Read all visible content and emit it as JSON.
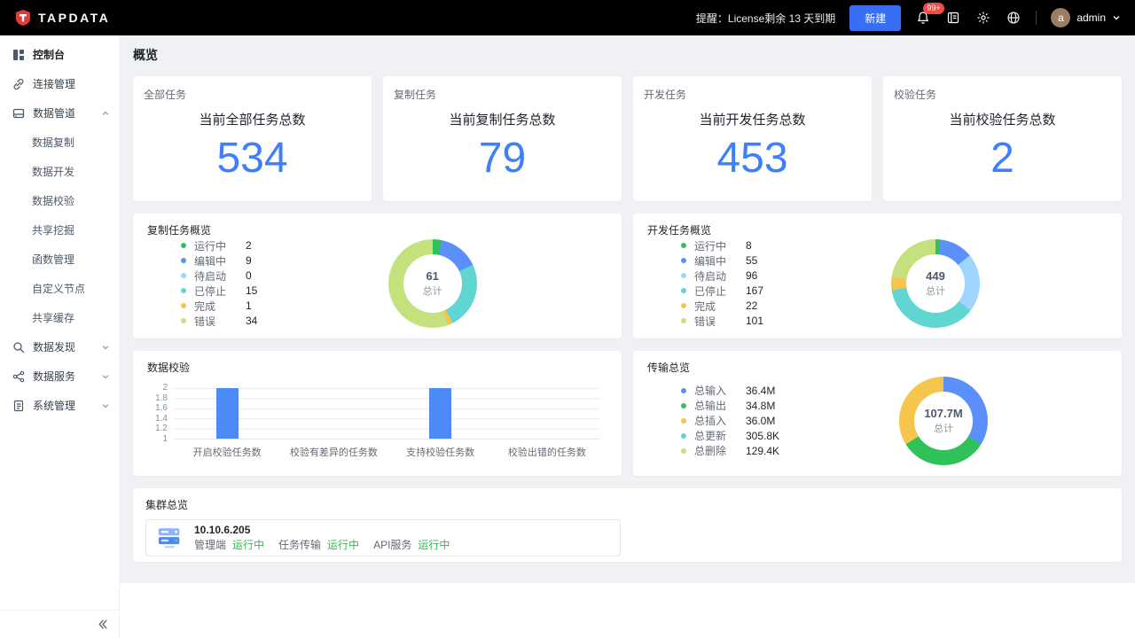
{
  "colors": {
    "accent": "#3d7ffc",
    "success": "#27c24c",
    "navbar_bg": "#000000",
    "badge_red": "#f54a45"
  },
  "navbar": {
    "brand": "TAPDATA",
    "license_notice": "提醒：License剩余 13 天到期",
    "new_button_label": "新建",
    "notification_badge": "99+",
    "avatar_letter": "a",
    "username": "admin"
  },
  "sidebar": {
    "items": [
      {
        "label": "控制台",
        "icon": "dashboard-icon",
        "active": true
      },
      {
        "label": "连接管理",
        "icon": "connection-icon"
      },
      {
        "label": "数据管道",
        "icon": "pipeline-icon",
        "expanded": true,
        "children": [
          "数据复制",
          "数据开发",
          "数据校验",
          "共享挖掘",
          "函数管理",
          "自定义节点",
          "共享缓存"
        ]
      },
      {
        "label": "数据发现",
        "icon": "discovery-icon",
        "expanded": false
      },
      {
        "label": "数据服务",
        "icon": "service-icon",
        "expanded": false
      },
      {
        "label": "系统管理",
        "icon": "system-icon",
        "expanded": false
      }
    ]
  },
  "page": {
    "title": "概览"
  },
  "stat_cards": [
    {
      "tag": "全部任务",
      "title": "当前全部任务总数",
      "value": "534"
    },
    {
      "tag": "复制任务",
      "title": "当前复制任务总数",
      "value": "79"
    },
    {
      "tag": "开发任务",
      "title": "当前开发任务总数",
      "value": "453"
    },
    {
      "tag": "校验任务",
      "title": "当前校验任务总数",
      "value": "2"
    }
  ],
  "chart_data": [
    {
      "type": "pie",
      "variant": "donut",
      "title": "复制任务概览",
      "legend_position": "left",
      "labels": [
        "运行中",
        "编辑中",
        "待启动",
        "已停止",
        "完成",
        "错误"
      ],
      "values": [
        2,
        9,
        0,
        15,
        1,
        34
      ],
      "display_values": [
        "2",
        "9",
        "0",
        "15",
        "1",
        "34"
      ],
      "center_total": "61",
      "center_label": "总计",
      "colors": [
        "#2fc25b",
        "#5b8ff9",
        "#9fd4fd",
        "#5fd6d2",
        "#f6c54c",
        "#c5e17e"
      ]
    },
    {
      "type": "pie",
      "variant": "donut",
      "title": "开发任务概览",
      "legend_position": "left",
      "labels": [
        "运行中",
        "编辑中",
        "待启动",
        "已停止",
        "完成",
        "错误"
      ],
      "values": [
        8,
        55,
        96,
        167,
        22,
        101
      ],
      "display_values": [
        "8",
        "55",
        "96",
        "167",
        "22",
        "101"
      ],
      "center_total": "449",
      "center_label": "总计",
      "colors": [
        "#2fc25b",
        "#5b8ff9",
        "#9fd4fd",
        "#5fd6d2",
        "#f6c54c",
        "#c5e17e"
      ]
    },
    {
      "type": "bar",
      "title": "数据校验",
      "grid": true,
      "categories": [
        "开启校验任务数",
        "校验有差异的任务数",
        "支持校验任务数",
        "校验出错的任务数"
      ],
      "values": [
        2,
        0,
        2,
        0
      ],
      "ylim": [
        1,
        2
      ],
      "yticks": [
        "2",
        "1.8",
        "1.6",
        "1.4",
        "1.2",
        "1"
      ],
      "bar_color": "#4c8af8"
    },
    {
      "type": "pie",
      "variant": "donut",
      "title": "传输总览",
      "legend_position": "left",
      "labels": [
        "总输入",
        "总输出",
        "总插入",
        "总更新",
        "总删除"
      ],
      "values": [
        36400000,
        34800000,
        36000000,
        305800,
        129400
      ],
      "display_values": [
        "36.4M",
        "34.8M",
        "36.0M",
        "305.8K",
        "129.4K"
      ],
      "center_total": "107.7M",
      "center_label": "总计",
      "colors": [
        "#5b8ff9",
        "#2fc25b",
        "#f6c54c",
        "#5fd6d2",
        "#c5e17e"
      ]
    }
  ],
  "cluster": {
    "title": "集群总览",
    "host": "10.10.6.205",
    "services": [
      {
        "name": "管理端",
        "status": "运行中"
      },
      {
        "name": "任务传输",
        "status": "运行中"
      },
      {
        "name": "API服务",
        "status": "运行中"
      }
    ]
  }
}
